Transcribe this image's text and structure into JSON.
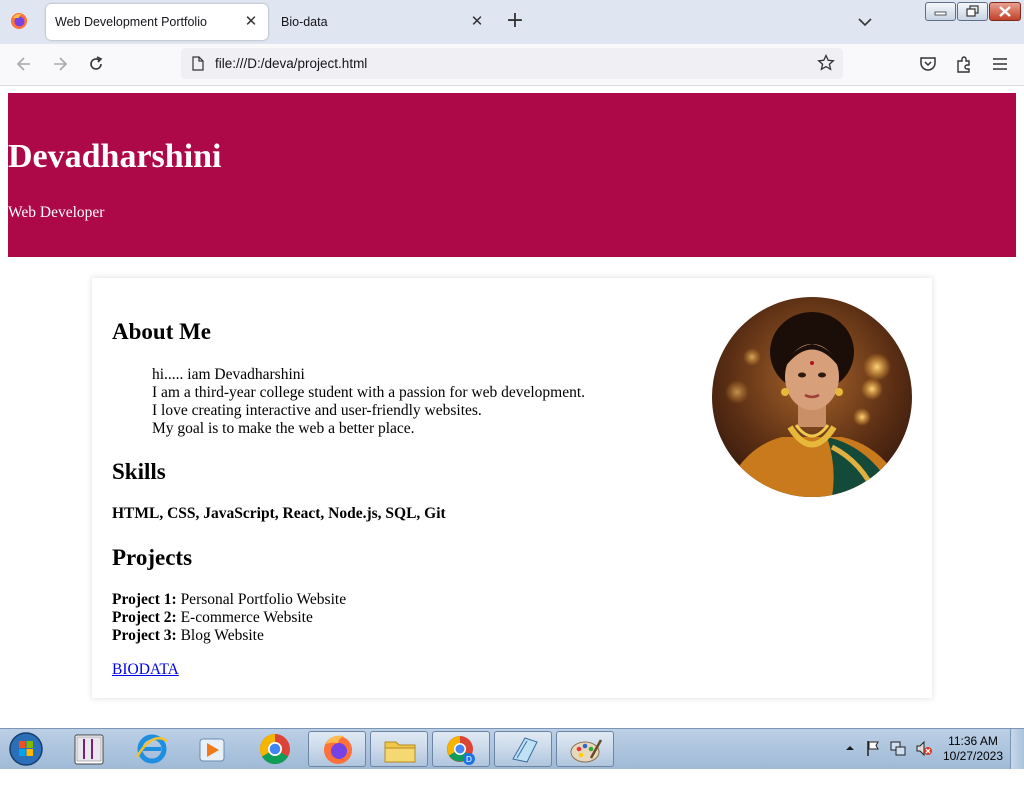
{
  "browser": {
    "tabs": [
      {
        "title": "Web Development Portfolio",
        "active": true
      },
      {
        "title": "Bio-data",
        "active": false
      }
    ],
    "close_glyph": "✕",
    "newtab_glyph": "+",
    "url": "file:///D:/deva/project.html"
  },
  "page": {
    "header": {
      "name": "Devadharshini",
      "role": "Web Developer",
      "bg_color": "#ad0848"
    },
    "about": {
      "heading": "About Me",
      "lines": [
        "hi..... iam Devadharshini",
        "I am a third-year college student with a passion for web development.",
        "I love creating interactive and user-friendly websites.",
        "My goal is to make the web a better place."
      ]
    },
    "skills": {
      "heading": "Skills",
      "list": "HTML, CSS, JavaScript, React, Node.js, SQL, Git"
    },
    "projects": {
      "heading": "Projects",
      "items": [
        {
          "label": "Project 1:",
          "name": "Personal Portfolio Website"
        },
        {
          "label": "Project 2:",
          "name": "E-commerce Website"
        },
        {
          "label": "Project 3:",
          "name": "Blog Website"
        }
      ]
    },
    "link": {
      "text": "BIODATA",
      "color": "#0000ee"
    }
  },
  "taskbar": {
    "apps": [
      "start-orb-icon",
      "tally-icon",
      "internet-explorer-icon",
      "media-player-icon",
      "chrome-icon",
      "firefox-icon",
      "file-explorer-icon",
      "chrome-profile-icon",
      "notepad-icon",
      "paint-icon"
    ],
    "time": "11:36 AM",
    "date": "10/27/2023"
  }
}
